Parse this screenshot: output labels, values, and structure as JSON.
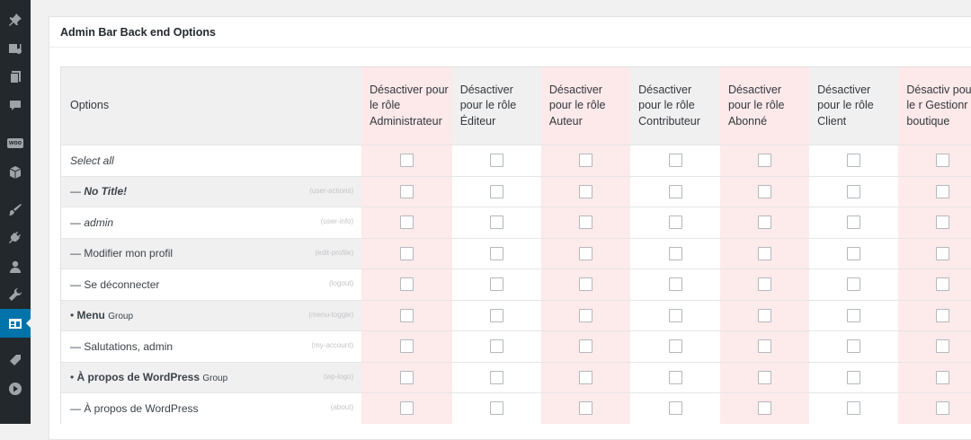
{
  "sidebar": {
    "icons": [
      "pin-icon",
      "media-icon",
      "pages-icon",
      "comments-icon",
      "woocommerce-icon",
      "products-icon",
      "appearance-icon",
      "plugins-icon",
      "users-icon",
      "tools-icon",
      "admin-bar-settings-icon",
      "tag-icon",
      "play-icon"
    ],
    "woo_badge": "woo"
  },
  "panel": {
    "title": "Admin Bar Back end Options"
  },
  "table": {
    "options_header": "Options",
    "role_headers": [
      "Désactiver pour le rôle Administrateur",
      "Désactiver pour le rôle Éditeur",
      "Désactiver pour le rôle Auteur",
      "Désactiver pour le rôle Contributeur",
      "Désactiver pour le rôle Abonné",
      "Désactiver pour le rôle Client",
      "Désactiv pour le r Gestionr boutique"
    ],
    "rows": [
      {
        "prefix": "",
        "name": "Select all",
        "group": "",
        "slug": ""
      },
      {
        "prefix": "— ",
        "name": "No Title!",
        "group": "",
        "slug": "(user-actions)"
      },
      {
        "prefix": "— ",
        "name": "admin",
        "group": "",
        "slug": "(user-info)"
      },
      {
        "prefix": "— ",
        "name": "Modifier mon profil",
        "group": "",
        "slug": "(edit-profile)"
      },
      {
        "prefix": "— ",
        "name": "Se déconnecter",
        "group": "",
        "slug": "(logout)"
      },
      {
        "prefix": "• ",
        "name": "Menu",
        "group": "Group",
        "slug": "(menu-toggle)"
      },
      {
        "prefix": "— ",
        "name": "Salutations, admin",
        "group": "",
        "slug": "(my-account)"
      },
      {
        "prefix": "• ",
        "name": "À propos de WordPress",
        "group": "Group",
        "slug": "(wp-logo)"
      },
      {
        "prefix": "— ",
        "name": "À propos de WordPress",
        "group": "",
        "slug": "(about)"
      }
    ]
  }
}
